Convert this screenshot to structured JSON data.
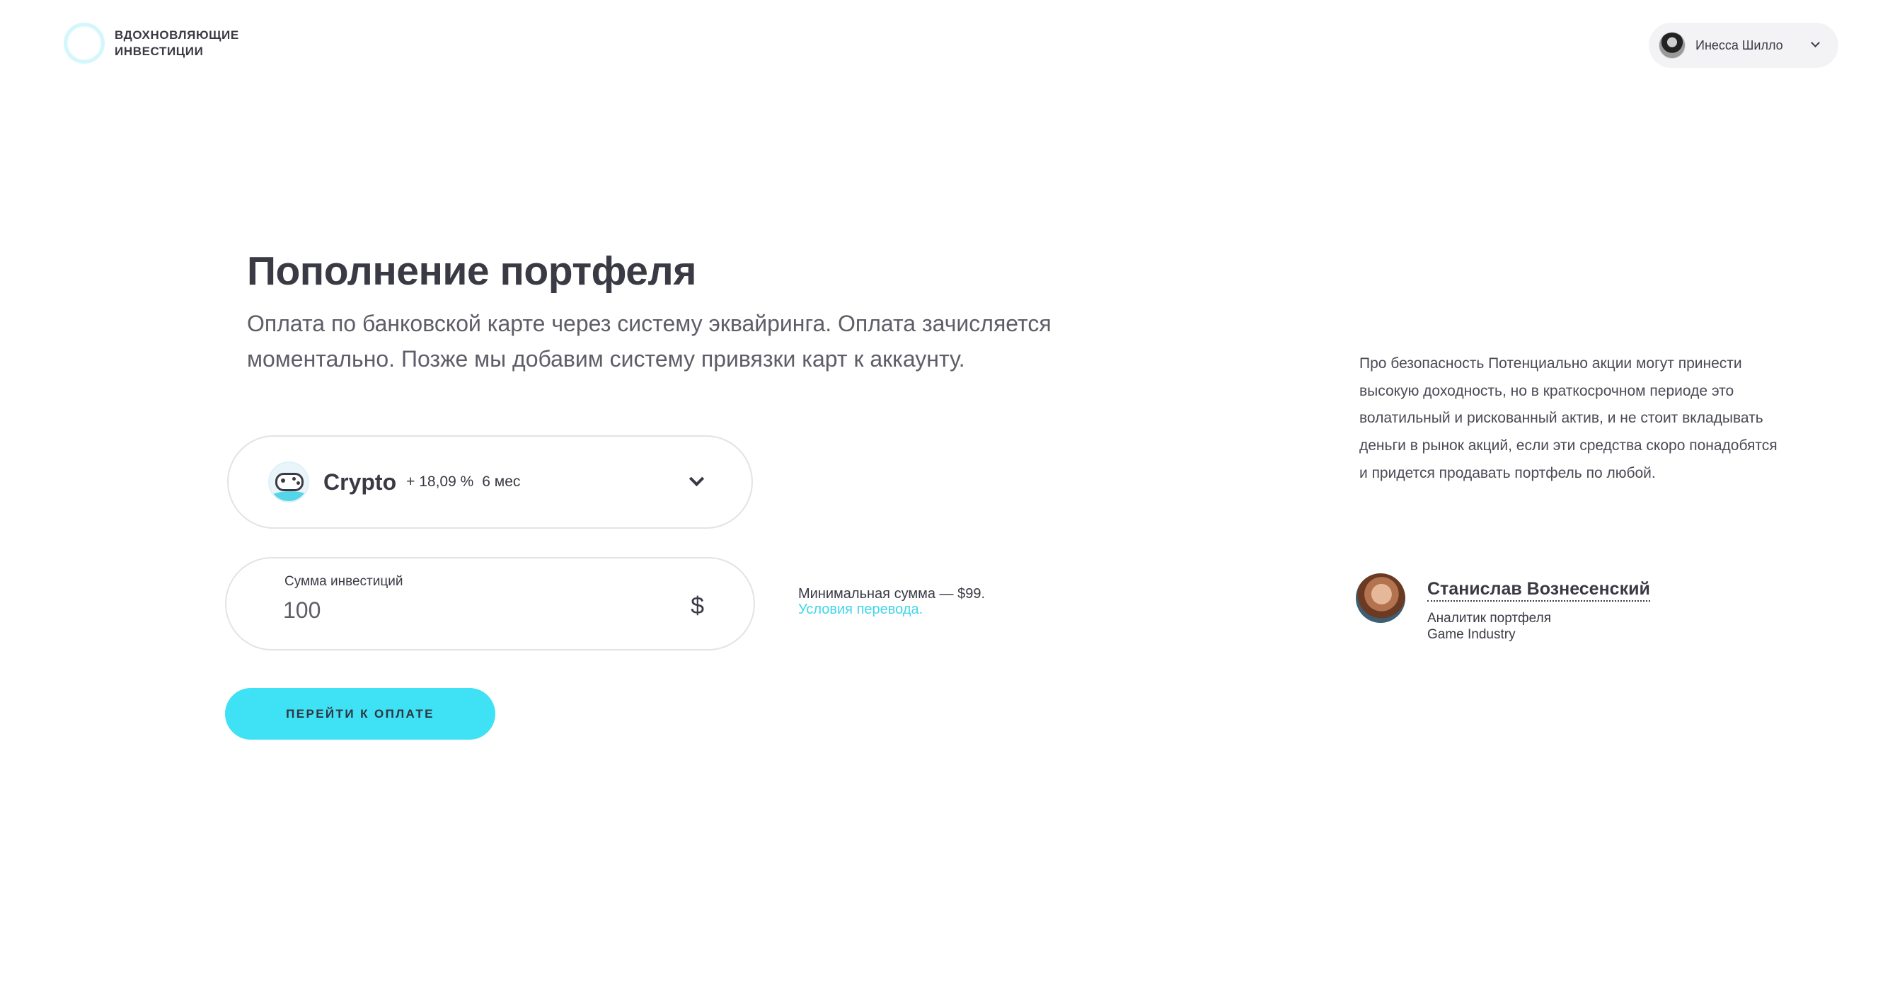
{
  "header": {
    "logo_line1": "ВДОХНОВЛЯЮЩИЕ",
    "logo_line2": "ИНВЕСТИЦИИ",
    "user_name": "Инесса Шилло",
    "icons": [
      "logo-ring-icon",
      "user-avatar",
      "chevron-down-icon"
    ]
  },
  "main": {
    "title": "Пополнение портфеля",
    "subtitle": "Оплата по банковской карте через систему эквайринга. Оплата зачисляется моментально. Позже мы добавим систему привязки карт к аккаунту.",
    "portfolio_select": {
      "name": "Crypto",
      "rate": "+ 18,09 %",
      "period": "6 мес",
      "icon": "gamepad-icon"
    },
    "amount": {
      "label": "Сумма инвестиций",
      "value": "100",
      "currency": "$"
    },
    "min_note": "Минимальная сумма — $99.",
    "terms_link": "Условия перевода.",
    "pay_button": "ПЕРЕЙТИ К ОПЛАТЕ"
  },
  "sidebar": {
    "advice": "Про безопасность Потенциально акции могут принести высокую доходность, но в краткосрочном периоде это волатильный и рискованный актив, и не стоит вкладывать деньги в рынок акций, если эти средства скоро понадобятся и придется продавать портфель по любой.",
    "analyst": {
      "name": "Станислав Вознесенский",
      "role": "Аналитик портфеля",
      "industry": "Game Industry"
    }
  },
  "colors": {
    "accent": "#3fe1f5",
    "link": "#3fd6ea",
    "text": "#3a3a45",
    "border": "#e3e3e6"
  }
}
